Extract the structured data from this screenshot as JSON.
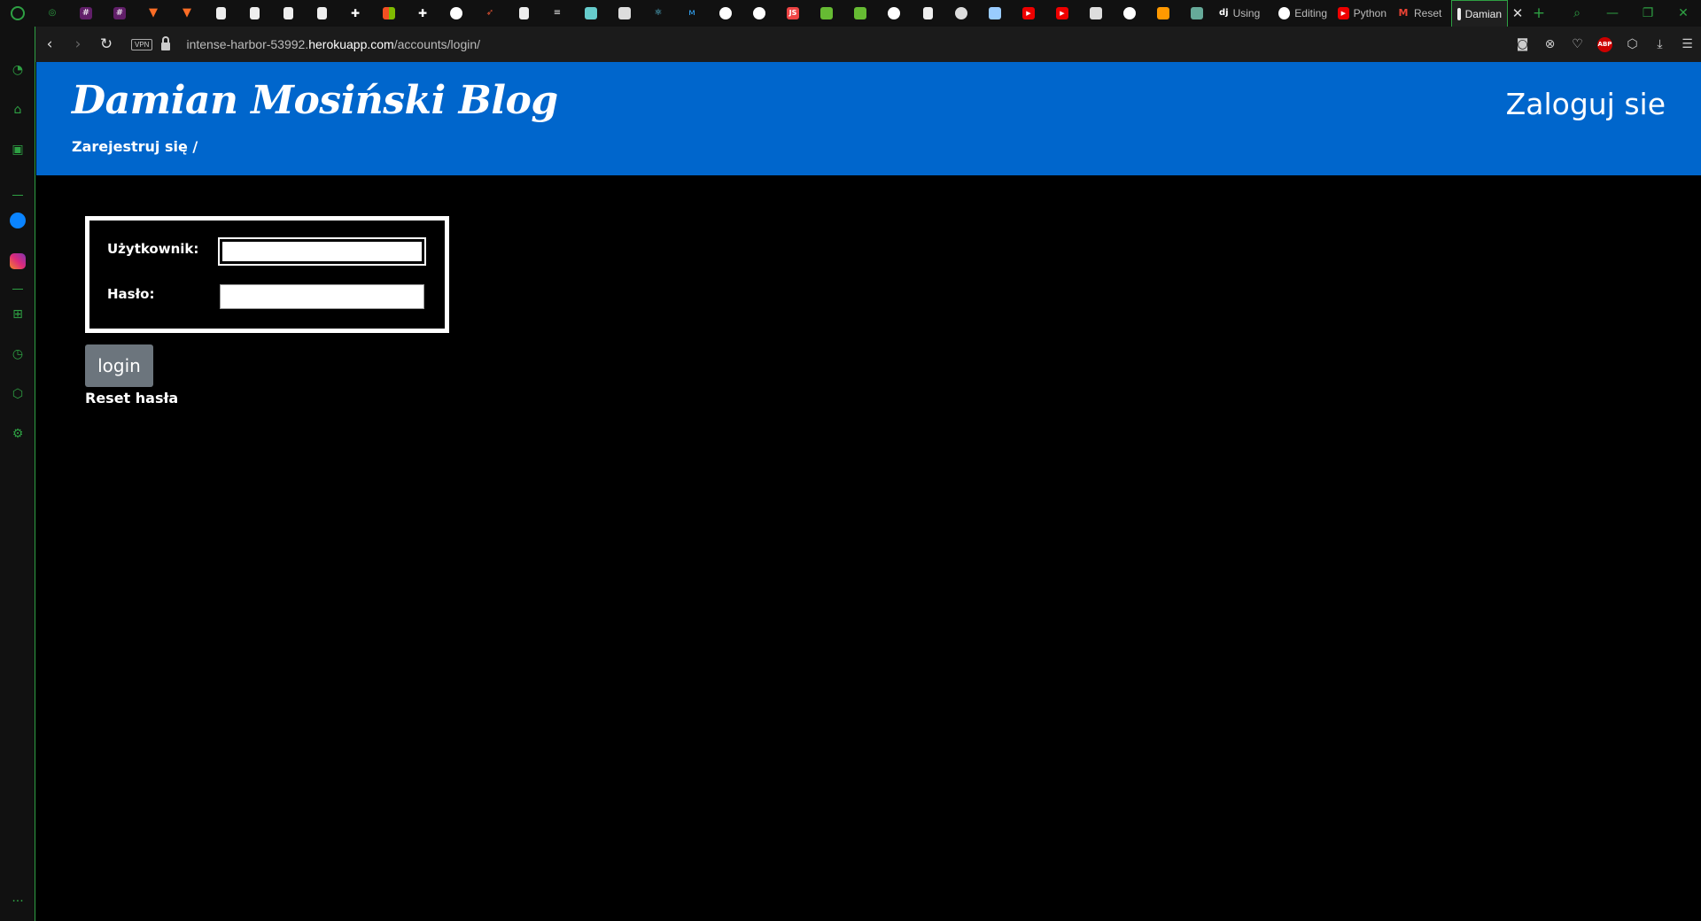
{
  "browser": {
    "tabs": [
      {
        "label": "Using",
        "icon": "django-icon"
      },
      {
        "label": "Editing",
        "icon": "github-icon"
      },
      {
        "label": "Python",
        "icon": "youtube-icon"
      },
      {
        "label": "Reset",
        "icon": "gmail-icon"
      },
      {
        "label": "Damian",
        "icon": "page-icon",
        "active": true
      }
    ],
    "pinned_icons": [
      "gamepad-icon",
      "slack-icon",
      "slack-icon",
      "gitlab-icon",
      "gitlab-icon",
      "page-icon",
      "page-icon",
      "page-icon",
      "page-icon",
      "python-icon",
      "microsoft-icon",
      "python-icon",
      "github-icon",
      "rocket-icon",
      "page-icon",
      "stackoverflow-icon",
      "bookmark-icon",
      "code-icon",
      "react-icon",
      "code-icon",
      "github-icon",
      "github-icon",
      "js-icon",
      "chart-icon",
      "chart-icon",
      "github-icon",
      "page-icon",
      "globe-icon",
      "book-icon",
      "youtube-icon",
      "youtube-icon",
      "bulb-icon",
      "github-icon",
      "orange-icon",
      "image-icon"
    ],
    "url_prefix": "intense-harbor-53992.",
    "url_domain": "herokuapp.com",
    "url_path": "/accounts/login/",
    "vpn_label": "VPN",
    "abp_label": "ABP"
  },
  "site": {
    "title": "Damian Mosiński Blog",
    "register_link": "Zarejestruj się /",
    "login_heading": "Zaloguj sie"
  },
  "form": {
    "username_label": "Użytkownik:",
    "username_value": "",
    "password_label": "Hasło:",
    "password_value": "",
    "submit_label": "login",
    "reset_link": "Reset hasła"
  },
  "colors": {
    "header_bg": "#0066cc",
    "page_bg": "#000000",
    "button_bg": "#6c757d",
    "accent": "#2ea043"
  }
}
